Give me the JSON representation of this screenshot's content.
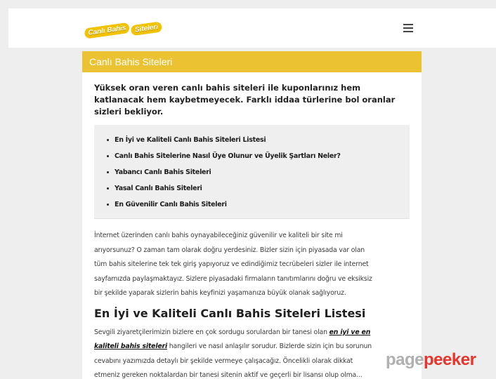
{
  "header": {
    "logo_part1": "Canlı Bahis",
    "logo_part2": "Siteleri"
  },
  "main": {
    "title": "Canlı Bahis Siteleri",
    "lead": "Yüksek oran veren canlı bahis siteleri ile kuponlarınız hem katlanacak hem kaybetmeyecek. Farklı iddaa türlerine bol oranlar sizleri bekliyor.",
    "toc": [
      "En İyi ve Kaliteli Canlı Bahis Siteleri Listesi",
      "Canlı Bahis Sitelerine Nasıl Üye Olunur ve Üyelik Şartları Neler?",
      "Yabancı Canlı Bahis Siteleri",
      "Yasal Canlı Bahis Siteleri",
      "En Güvenilir Canlı Bahis Siteleri"
    ],
    "intro_lines": [
      "İnternet üzerinden canlı bahis oynayabileceğiniz güvenilir ve kaliteli bir site mi",
      "arıyorsunuz? O zaman tam olarak doğru yerdesiniz. Bizler sizin için piyasada var olan",
      "tüm bahis sitelerine tek tek giriş yapıyoruz ve edindiğimiz tecrübeleri sizler ile internet",
      "sayfamızda paylaşmaktayız. Sizlere piyasadaki firmaların tanıtımlarını doğru ve eksiksiz",
      "bir şekilde yaparak sizlerin bahis keyfinizi yaşamanıza büyük olanak sağlıyoruz."
    ],
    "section_heading": "En İyi ve Kaliteli Canlı Bahis Siteleri Listesi",
    "section_para": {
      "line1_text": "Sevgili ziyaretçilerimizin bizlere en çok sordugu sorulardan bir tanesi olan ",
      "line1_link": "en iyi ve en",
      "line2_link": "kaliteli bahis siteleri",
      "line2_text": " hangileri ve nasıl anlaşılır sorudur. Bizlerde sizin için bu sorunun",
      "line3": "cevabını yazımızda detaylı bir şekilde vermeye çalışacağız.  Öncelikli olarak dikkat",
      "line4": "etmeniz gereken noktalardan bir tanesi sitenin aktif ve geçerli bir lisansı olup olma..."
    }
  },
  "watermark": {
    "part1": "page",
    "part2": "peeker"
  }
}
